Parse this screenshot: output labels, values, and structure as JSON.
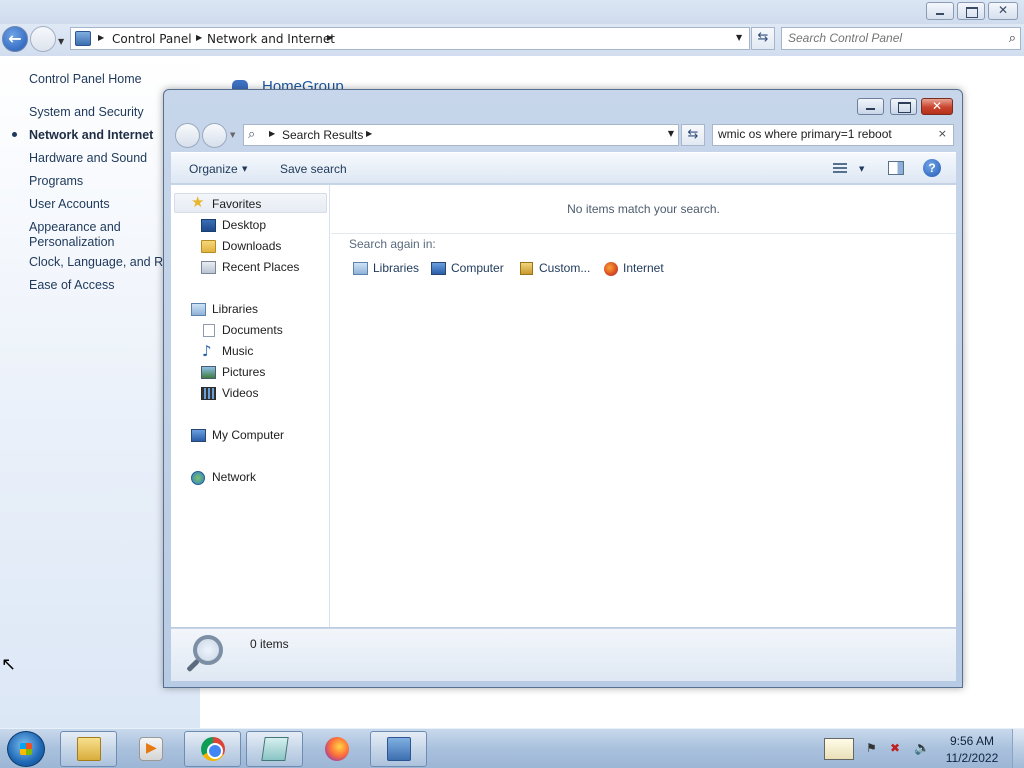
{
  "control_panel": {
    "breadcrumbs": [
      "Control Panel",
      "Network and Internet"
    ],
    "search_placeholder": "Search Control Panel",
    "sidebar": {
      "home": "Control Panel Home",
      "items": [
        {
          "label": "System and Security",
          "active": false
        },
        {
          "label": "Network and Internet",
          "active": true
        },
        {
          "label": "Hardware and Sound",
          "active": false
        },
        {
          "label": "Programs",
          "active": false
        },
        {
          "label": "User Accounts",
          "active": false
        },
        {
          "label": "Appearance and",
          "active": false
        },
        {
          "label": "Personalization",
          "active": false
        },
        {
          "label": "Clock, Language, and Reg",
          "active": false
        },
        {
          "label": "Ease of Access",
          "active": false
        }
      ]
    },
    "main_heading": "HomeGroup"
  },
  "explorer": {
    "address_label": "Search Results",
    "search_value": "wmic os where primary=1 reboot",
    "search_clear": "×",
    "toolbar": {
      "organize": "Organize",
      "save_search": "Save search",
      "help": "?"
    },
    "nav_pane": {
      "favorites": "Favorites",
      "desktop": "Desktop",
      "downloads": "Downloads",
      "recent_places": "Recent Places",
      "libraries": "Libraries",
      "documents": "Documents",
      "music": "Music",
      "pictures": "Pictures",
      "videos": "Videos",
      "my_computer": "My Computer",
      "network": "Network"
    },
    "content": {
      "empty_message": "No items match your search.",
      "search_again_label": "Search again in:",
      "search_again_items": [
        "Libraries",
        "Computer",
        "Custom...",
        "Internet"
      ]
    },
    "details": {
      "count": "0 items"
    }
  },
  "taskbar": {
    "apps": [
      "windows-explorer",
      "media-player",
      "chrome",
      "notepad",
      "firefox",
      "control-panel"
    ],
    "clock_time": "9:56 AM",
    "clock_date": "11/2/2022"
  }
}
